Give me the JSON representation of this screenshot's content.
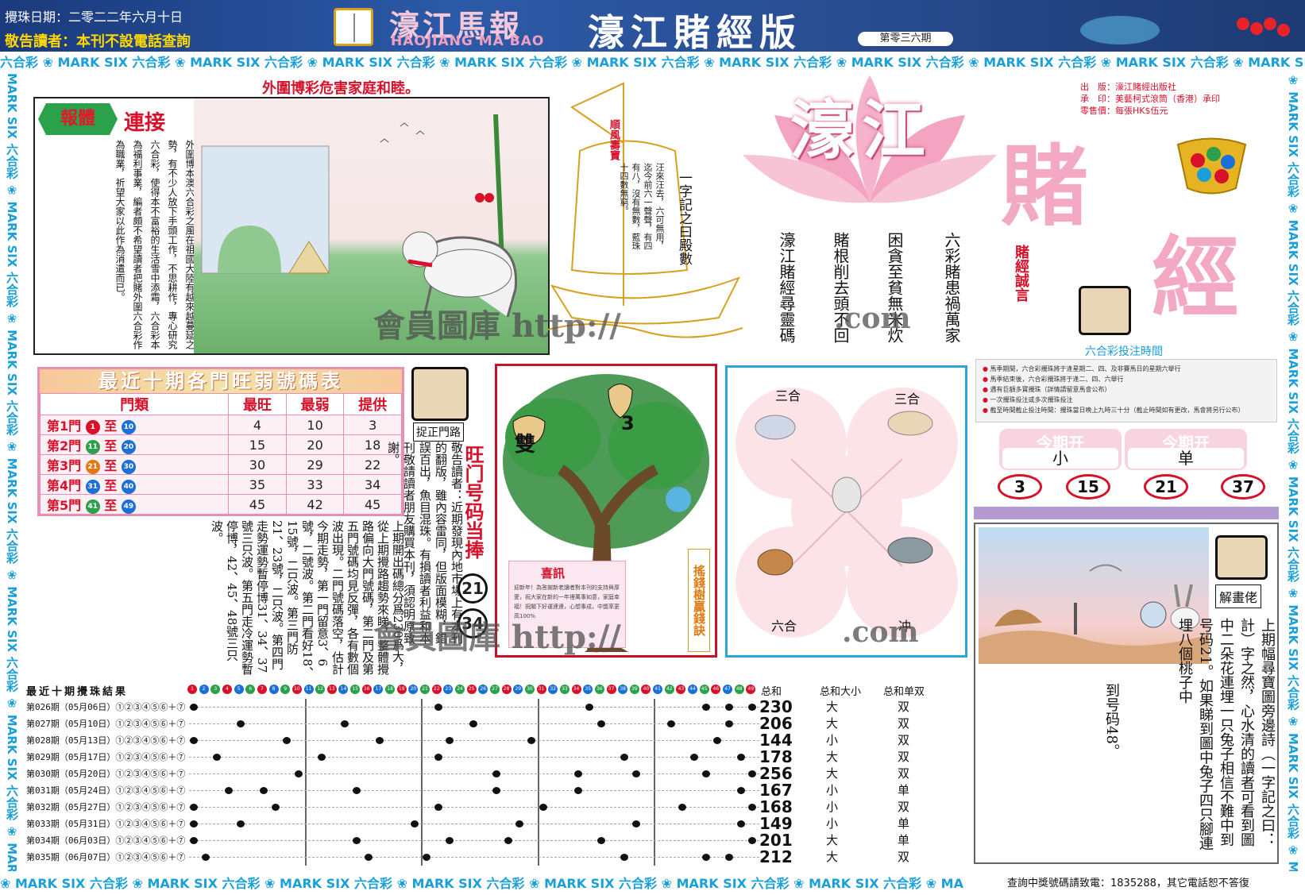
{
  "header": {
    "date": "攪珠日期：二零二二年六月十日",
    "notice": "敬告讀者：本刊不設電話查詢",
    "logo_cn": "濠江馬報",
    "logo_en": "HAOJIANG MA BAO",
    "main_title": "濠江賭經版",
    "issue": "第零三六期"
  },
  "banners": {
    "top": "六合彩 ❀ MARK SIX 六合彩 ❀ MARK SIX 六合彩 ❀ MARK SIX 六合彩 ❀ MARK SIX 六合彩 ❀ MARK SIX 六合彩 ❀ MARK SIX 六合彩 ❀ MARK SIX 六合彩 ❀ MARK SIX 六合彩 ❀ MARK SIX 六合彩 ❀ MARK SIX",
    "bottom": "❀ MARK SIX 六合彩 ❀ MARK SIX 六合彩 ❀ MARK SIX 六合彩 ❀ MARK SIX 六合彩 ❀ MARK SIX 六合彩 ❀ MARK SIX 六合彩 ❀ MARK SIX 六合彩 ❀ MA",
    "left": "MARK SIX 六合彩 ❀ MARK SIX 六合彩 ❀ MARK SIX 六合彩 ❀ MARK SIX 六合彩 ❀ MARK SIX 六合彩 ❀ MARK SIX 六合彩 ❀ MARK SIX 六合彩 ❀",
    "right": "❀ MARK SIX 六合彩 ❀ MARK SIX 六合彩 ❀ MARK SIX 六合彩 ❀ MARK SIX 六合彩 ❀ MARK SIX 六合彩 ❀ MARK SIX 六合彩 ❀ MARK SIX 六合彩"
  },
  "story": {
    "warning_title": "外圍博彩危害家庭和睦。",
    "badge_left": "報體",
    "badge_right": "連接",
    "text": "外圍博本澳六合彩之風在祖國大陸有越來越蔓延之勢，有不少人放下手頭工作，不思耕作，專心研究六合彩，使得本不富裕的生活雪中添霜，六合彩本為福利事業，編者頗不希望讀者把賭外圍六合彩作為職業，祈望大家以此作為消遣而已。"
  },
  "ship": {
    "flag_text": "順風壽寶",
    "poem": "汪來汪去，六可無用，迄今前六一聲聲，有四有八，沒有無數，藍珠十四數無窮。",
    "heading": "一字記之曰殿數"
  },
  "watermarks": {
    "w1": "會員圖庫 http://",
    "w2": ".com",
    "w3": "會員圖庫 http://",
    "w4": ".com"
  },
  "big_title": {
    "part1": "濠江",
    "part2": "賭",
    "part3": "經"
  },
  "publication": {
    "publisher": "出　版：濠江賭經出版社",
    "printer": "承　印：美藝柯式滾筒（香港）承印",
    "price": "零售價：每張HK$伍元"
  },
  "motto": {
    "label": "賭經誠言",
    "col1": "六彩賭患禍萬家",
    "col2": "困貪至貧無米炊",
    "col3": "賭根削去頭不回",
    "col4": "濠江賭經尋靈碼"
  },
  "bet_time": {
    "title": "六合彩投注時間",
    "items": [
      "馬季期間，六合彩攪珠將于逢星期二、四、及非賽馬日的星期六舉行",
      "馬季結束後，六合彩攪珠將于逢二、四、六舉行",
      "遇有巨額多寶攪珠（詳情請留意馬會公布）",
      "一次攪珠投注或多次攪珠投注",
      "截至時間截止投注時間：攪珠當日晚上九時三十分（截止時間如有更改，馬會將另行公布）"
    ]
  },
  "this_issue": {
    "head1": "今期开",
    "val1": "小",
    "head2": "今期开",
    "val2": "单",
    "numbers": [
      "3",
      "15",
      "21",
      "37"
    ]
  },
  "ten_table": {
    "title": "最近十期各門旺弱號碼表",
    "headers": [
      "門類",
      "最旺",
      "最弱",
      "提供"
    ],
    "rows": [
      {
        "door": "第1門",
        "from": "1",
        "to": "10",
        "hot": "4",
        "cold": "10",
        "tip": "3"
      },
      {
        "door": "第2門",
        "from": "11",
        "to": "20",
        "hot": "15",
        "cold": "20",
        "tip": "18"
      },
      {
        "door": "第3門",
        "from": "21",
        "to": "30",
        "hot": "30",
        "cold": "29",
        "tip": "22"
      },
      {
        "door": "第4門",
        "from": "31",
        "to": "40",
        "hot": "35",
        "cold": "33",
        "tip": "34"
      },
      {
        "door": "第5門",
        "from": "41",
        "to": "49",
        "hot": "45",
        "cold": "42",
        "tip": "45"
      }
    ],
    "to_word": "至"
  },
  "zheng": {
    "label": "捉正門路",
    "warn_text": "敬告讀者：近期發現內地市場上有本刊的翻版，雖內容雷同，但版面模糊，錯誤百出，魚目混珠。有損讀者利益和本刊敬請讀者朋友購買本刊，須認明原致謝。",
    "wangmen_title": "旺门号码当捧",
    "num1": "21",
    "num2": "34"
  },
  "analysis": {
    "text": "上期開出碼總分爲230爲大，從上期攪路趨勢來睇，整體攪路偏向大門號碼，第二門及第五門號碼均見反彈，各有數個波出現。二門號碼落空，估計今期走勢，第一門留意3、6號，二號波。第二門看好18、15號，二只波。第三門防21、23號，二只波。第四門走勢運勢暫停博31、34、37號三只波。第五門走冷運勢暫停博，42、45、48號三只波。"
  },
  "tree": {
    "label_shuang": "雙",
    "label_3": "3",
    "news_title": "喜訊",
    "news_text": "迎新年！為答謝新老讀者對本刊的支持與厚愛，祝大家在新的一年裡萬事如意，家庭幸福！祝閣下好運連連，心想事成，中獎率更高100%",
    "side_label": "搖錢樹贏錢訣"
  },
  "zodiac": {
    "tl": "三合",
    "tr": "三合",
    "bl": "六合",
    "br": "冲"
  },
  "riddle": {
    "label": "解畫佬",
    "text": "上期幅尋寶圖旁邊詩（一字記之曰：計）字之然，心水清的讀者可看到圖中二朵花連埋一只兔子相信不難中到号码21。如果睇到圖中兔子四只腳連埋八個桃子中",
    "answer": "到号码48。"
  },
  "results": {
    "title": "最近十期攪珠結果",
    "rows": [
      "第026期（05月06日）①②③④⑤⑥＋⑦",
      "第027期（05月10日）①②③④⑤⑥＋⑦",
      "第028期（05月13日）①②③④⑤⑥＋⑦",
      "第029期（05月17日）①②③④⑤⑥＋⑦",
      "第030期（05月20日）①②③④⑤⑥＋⑦",
      "第031期（05月24日）①②③④⑤⑥＋⑦",
      "第032期（05月27日）①②③④⑤⑥＋⑦",
      "第033期（05月31日）①②③④⑤⑥＋⑦",
      "第034期（06月03日）①②③④⑤⑥＋⑦",
      "第035期（06月07日）①②③④⑤⑥＋⑦"
    ],
    "sum_head": "总和",
    "size_head": "总和大小",
    "odd_head": "总和单双",
    "sums": [
      "230",
      "206",
      "144",
      "178",
      "256",
      "167",
      "168",
      "149",
      "201",
      "212"
    ],
    "sizes": [
      "大",
      "大",
      "小",
      "大",
      "大",
      "小",
      "小",
      "小",
      "大",
      "大"
    ],
    "odds": [
      "双",
      "双",
      "双",
      "双",
      "双",
      "单",
      "双",
      "单",
      "单",
      "双"
    ],
    "draws": [
      [
        1,
        22,
        35,
        45,
        49,
        47
      ],
      [
        5,
        14,
        25,
        36,
        42,
        47
      ],
      [
        1,
        9,
        17,
        23,
        30,
        46
      ],
      [
        3,
        12,
        22,
        38,
        44,
        48
      ],
      [
        10,
        27,
        34,
        39,
        45,
        49
      ],
      [
        4,
        7,
        15,
        27,
        34,
        48
      ],
      [
        1,
        8,
        22,
        31,
        43,
        49
      ],
      [
        1,
        5,
        20,
        29,
        39,
        48
      ],
      [
        1,
        15,
        23,
        28,
        36,
        49
      ],
      [
        2,
        16,
        21,
        38,
        45,
        47
      ]
    ]
  },
  "footer": {
    "phone": "查詢中獎號碼請致電：1835288，其它電話恕不答復"
  },
  "colors": {
    "red": "#d8102a",
    "blue": "#1a9fd8",
    "pink": "#f3a8c4",
    "green": "#2aa14a"
  }
}
